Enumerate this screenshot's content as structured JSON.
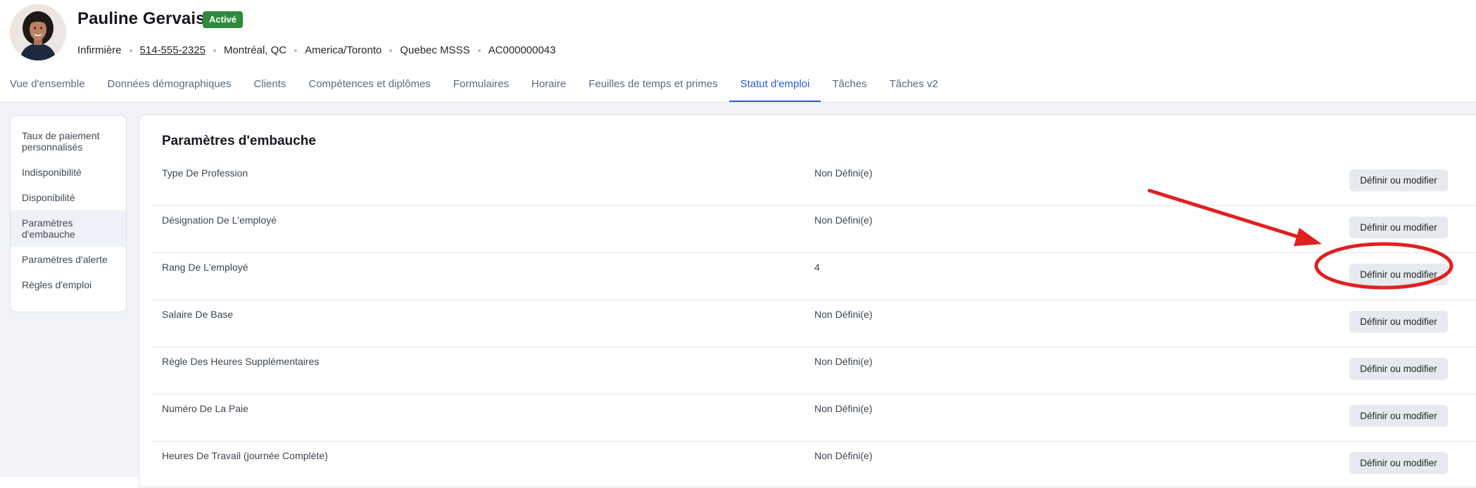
{
  "profile": {
    "name": "Pauline Gervais",
    "status": "Activé",
    "role": "Infirmière",
    "phone": "514-555-2325",
    "city": "Montréal, QC",
    "timezone": "America/Toronto",
    "organization": "Quebec MSSS",
    "id": "AC000000043"
  },
  "tabs": [
    {
      "label": "Vue d'ensemble"
    },
    {
      "label": "Données démographiques"
    },
    {
      "label": "Clients"
    },
    {
      "label": "Compétences et diplômes"
    },
    {
      "label": "Formulaires"
    },
    {
      "label": "Horaire"
    },
    {
      "label": "Feuilles de temps et primes"
    },
    {
      "label": "Statut d'emploi",
      "active": true
    },
    {
      "label": "Tâches"
    },
    {
      "label": "Tâches v2"
    }
  ],
  "sidenav": [
    {
      "label": "Taux de paiement personnalisés"
    },
    {
      "label": "Indisponibilité"
    },
    {
      "label": "Disponibilité"
    },
    {
      "label": "Paramètres d'embauche",
      "active": true
    },
    {
      "label": "Paramètres d'alerte"
    },
    {
      "label": "Règles d'emploi"
    }
  ],
  "panel": {
    "title": "Paramètres d'embauche",
    "button_label": "Définir ou modifier",
    "rows": [
      {
        "label": "Type De Profession",
        "value": "Non Défini(e)"
      },
      {
        "label": "Désignation De L'employé",
        "value": "Non Défini(e)"
      },
      {
        "label": "Rang De L'employé",
        "value": "4"
      },
      {
        "label": "Salaire De Base",
        "value": "Non Défini(e)"
      },
      {
        "label": "Règle Des Heures Supplémentaires",
        "value": "Non Défini(e)"
      },
      {
        "label": "Numéro De La Paie",
        "value": "Non Défini(e)"
      },
      {
        "label": "Heures De Travail (journée Complète)",
        "value": "Non Défini(e)"
      }
    ]
  },
  "colors": {
    "accent": "#2a5bd7",
    "status_badge": "#2f8a3e",
    "annotation": "#e02020"
  },
  "icons": {
    "avatar": "user-photo",
    "annotation_arrow": "red-arrow-icon",
    "annotation_circle": "red-circle-highlight"
  }
}
